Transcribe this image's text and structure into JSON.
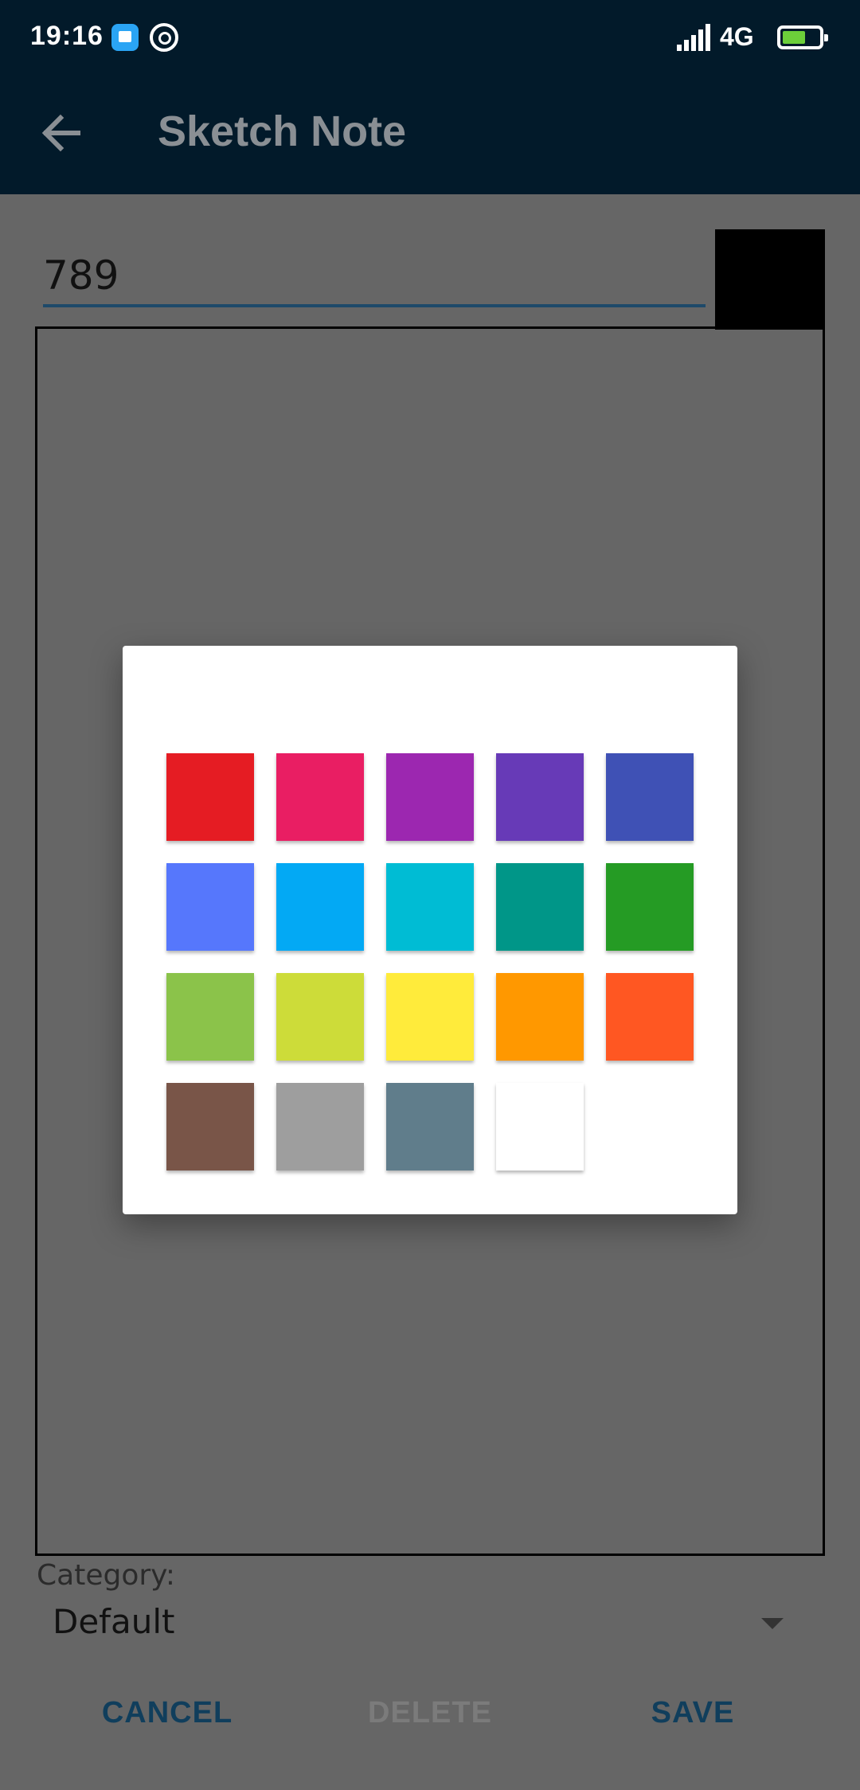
{
  "status_bar": {
    "time": "19:16",
    "network": "4G",
    "icons": [
      "app-notification-icon",
      "at-sign-icon",
      "signal-icon",
      "battery-charging-icon"
    ]
  },
  "app_bar": {
    "back_icon": "arrow-left-icon",
    "title": "Sketch Note"
  },
  "note": {
    "title_value": "789",
    "selected_color": "#000000"
  },
  "category": {
    "label": "Category:",
    "value": "Default"
  },
  "actions": {
    "cancel": "CANCEL",
    "delete": "DELETE",
    "save": "SAVE"
  },
  "color_picker": {
    "colors": [
      "#e51c23",
      "#e91e63",
      "#9c27b0",
      "#673ab7",
      "#3f51b5",
      "#5677fc",
      "#03a9f4",
      "#00bcd4",
      "#009688",
      "#259b24",
      "#8bc34a",
      "#cddc39",
      "#ffeb3b",
      "#ff9800",
      "#ff5722",
      "#795548",
      "#9e9e9e",
      "#607d8b",
      "#ffffff"
    ]
  },
  "theme": {
    "app_bar_bg": "#021a2a",
    "scrim_bg": "#666666",
    "accent": "#103e5c"
  }
}
